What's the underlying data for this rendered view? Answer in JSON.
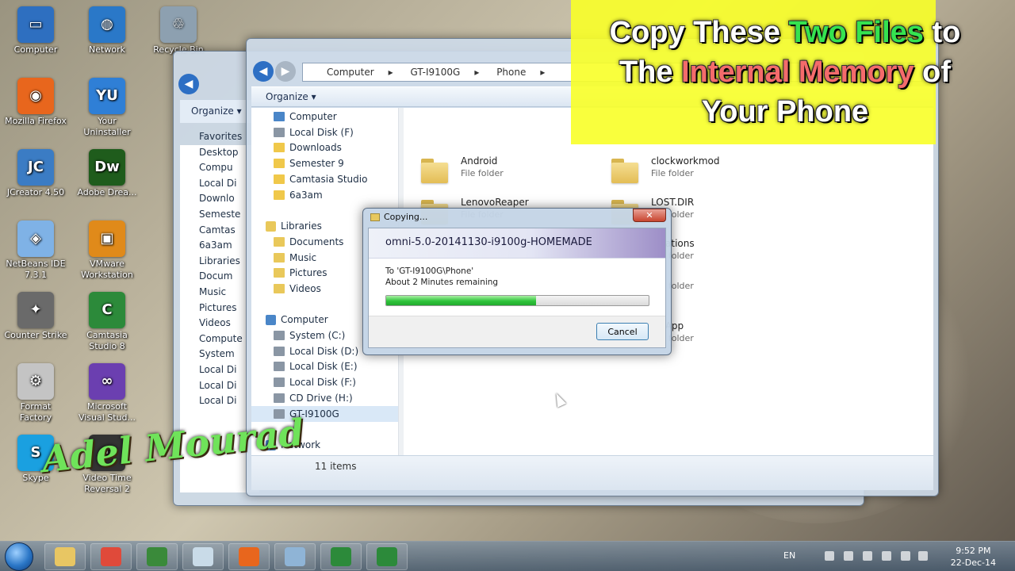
{
  "desktop": {
    "icons": [
      {
        "label": "Computer",
        "color": "#2e6fc0",
        "glyph": "▭"
      },
      {
        "label": "Network",
        "color": "#2a78c8",
        "glyph": "◍"
      },
      {
        "label": "Recycle Bin",
        "color": "#8da0b0",
        "glyph": "♲"
      },
      {
        "label": "Mozilla Firefox",
        "color": "#e8661d",
        "glyph": "◉"
      },
      {
        "label": "Your Uninstaller",
        "color": "#2f7fd6",
        "glyph": "YU"
      },
      {
        "label": "JCreator 4.50",
        "color": "#3b7cc4",
        "glyph": "JC"
      },
      {
        "label": "Adobe Drea...",
        "color": "#1f5c1c",
        "glyph": "Dw"
      },
      {
        "label": "NetBeans IDE 7.3.1",
        "color": "#7fb2e6",
        "glyph": "◈"
      },
      {
        "label": "VMware Workstation",
        "color": "#e08a1a",
        "glyph": "▣"
      },
      {
        "label": "Counter Strike",
        "color": "#6a6a6a",
        "glyph": "✦"
      },
      {
        "label": "Camtasia Studio 8",
        "color": "#2c8a3a",
        "glyph": "C"
      },
      {
        "label": "Format Factory",
        "color": "#c4c4c4",
        "glyph": "⚙"
      },
      {
        "label": "Microsoft Visual Stud...",
        "color": "#6b3fb0",
        "glyph": "∞"
      },
      {
        "label": "Skype",
        "color": "#1aa0e0",
        "glyph": "S"
      },
      {
        "label": "Video Time Reversal 2",
        "color": "#333333",
        "glyph": "◴"
      }
    ]
  },
  "back_window": {
    "organize": "Organize ▾",
    "items": [
      "Favorites",
      "Desktop",
      "Compu",
      "Local Di",
      "Downlo",
      "Semeste",
      "Camtas",
      "6a3am",
      "Libraries",
      "Docum",
      "Music",
      "Pictures",
      "Videos",
      "Compute",
      "System",
      "Local Di",
      "Local Di",
      "Local Di"
    ]
  },
  "explorer": {
    "address": [
      "Computer",
      "GT-I9100G",
      "Phone"
    ],
    "organize_label": "Organize",
    "nav": {
      "favorites": [
        "Computer",
        "Local Disk (F)",
        "Downloads",
        "Semester 9",
        "Camtasia Studio",
        "6a3am"
      ],
      "libraries_header": "Libraries",
      "libraries": [
        "Documents",
        "Music",
        "Pictures",
        "Videos"
      ],
      "computer_header": "Computer",
      "computer": [
        "System (C:)",
        "Local Disk (D:)",
        "Local Disk (E:)",
        "Local Disk (F:)",
        "CD Drive (H:)",
        "GT-I9100G"
      ],
      "network": "Network"
    },
    "folders": [
      {
        "name": "Android",
        "type": "File folder"
      },
      {
        "name": "clockworkmod",
        "type": "File folder"
      },
      {
        "name": "LenovoReaper",
        "type": "File folder"
      },
      {
        "name": "LOST.DIR",
        "type": "File folder"
      },
      {
        "name": "...cations",
        "type": "File folder"
      },
      {
        "name": "",
        "type": "File folder"
      },
      {
        "name": "...sApp",
        "type": "File folder"
      }
    ],
    "status_count": "11 items"
  },
  "copy_dialog": {
    "title": "Copying...",
    "close": "✕",
    "filename": "omni-5.0-20141130-i9100g-HOMEMADE",
    "destination": "To 'GT-I9100G\\Phone'",
    "remaining": "About 2 Minutes remaining",
    "progress_percent": 57,
    "cancel": "Cancel"
  },
  "overlay": {
    "line1_a": "Copy These ",
    "line1_b": "Two Files",
    "line1_c": " to",
    "line2_a": "The ",
    "line2_b": "Internal Memory",
    "line2_c": " of",
    "line3": "Your Phone",
    "watermark": "Adel Mourad"
  },
  "taskbar": {
    "apps": [
      {
        "name": "explorer",
        "color": "#e8c663"
      },
      {
        "name": "chrome",
        "color": "#e04a3a"
      },
      {
        "name": "chart",
        "color": "#3a8a3a"
      },
      {
        "name": "notepad",
        "color": "#c9dbe8"
      },
      {
        "name": "firefox",
        "color": "#e8661d"
      },
      {
        "name": "search",
        "color": "#8fb4d6"
      },
      {
        "name": "camtasia",
        "color": "#2c8a3a"
      },
      {
        "name": "camtasia-recorder",
        "color": "#2c8a3a"
      }
    ],
    "lang": "EN",
    "time": "9:52 PM",
    "date": "22-Dec-14"
  }
}
